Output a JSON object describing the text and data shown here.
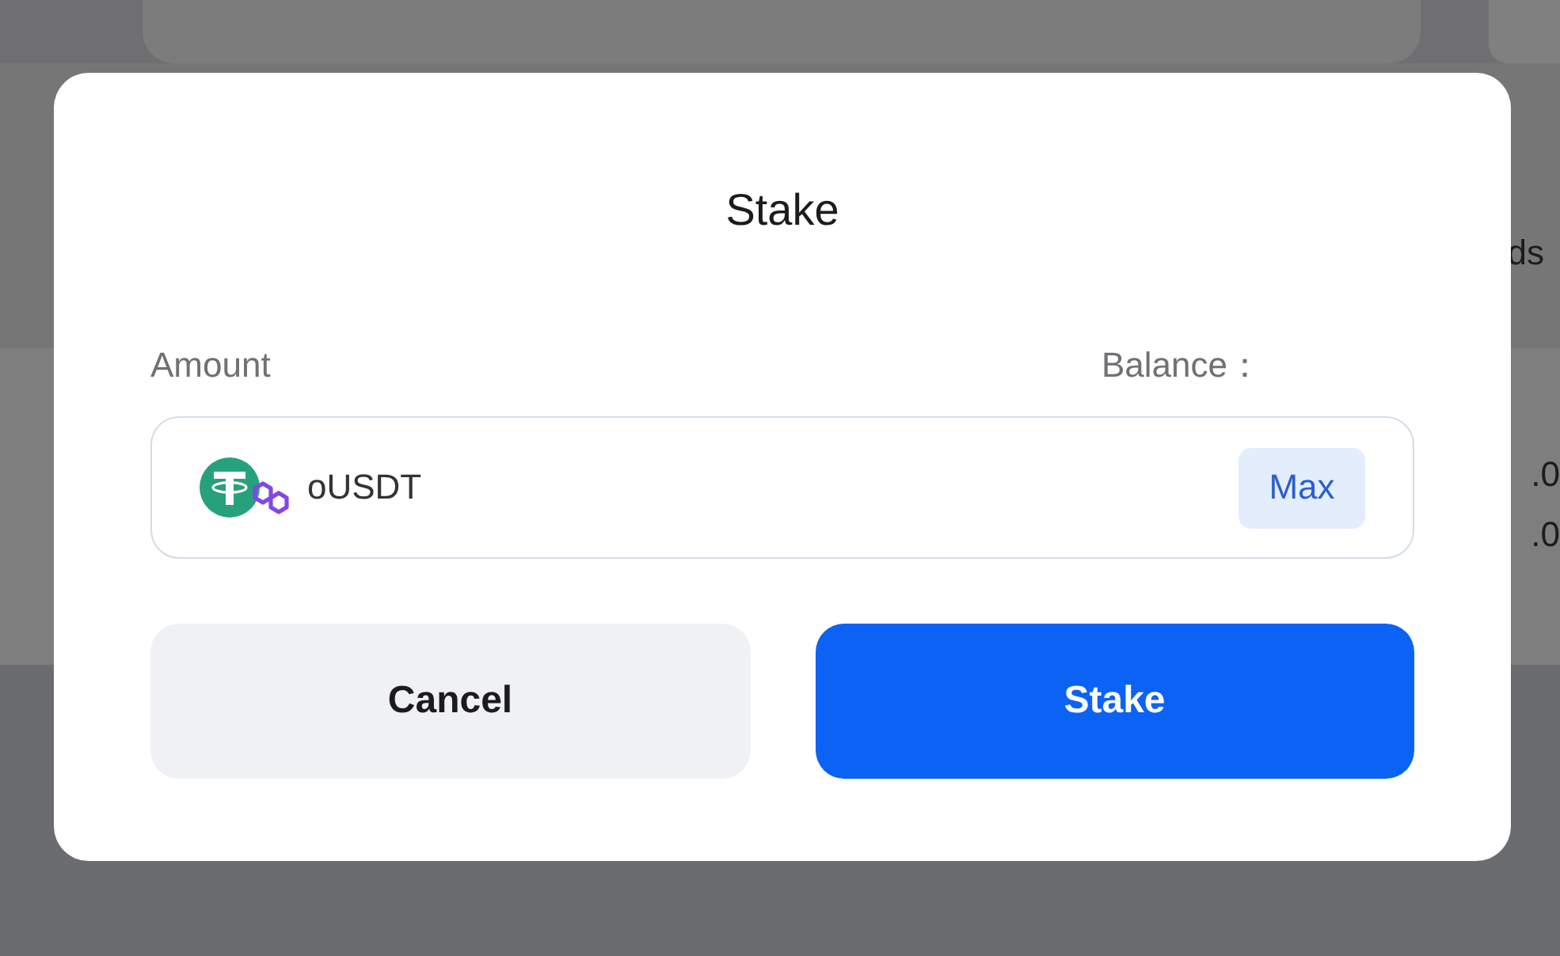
{
  "background_page": {
    "column_header": "ds",
    "row_values": [
      ".0",
      ".0"
    ]
  },
  "modal": {
    "title": "Stake",
    "amount_label": "Amount",
    "balance_label": "Balance：",
    "token_field": {
      "token": "oUSDT",
      "max_button": "Max"
    },
    "buttons": [
      {
        "label": "Cancel",
        "kind": "secondary"
      },
      {
        "label": "Stake",
        "kind": "primary"
      }
    ]
  }
}
